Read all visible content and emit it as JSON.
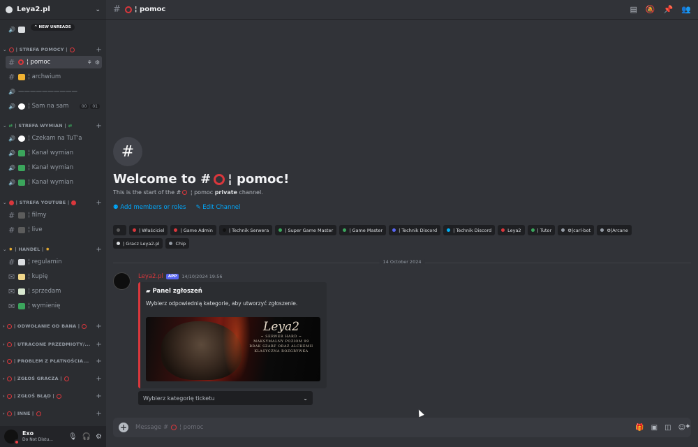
{
  "server": {
    "name": "Leya2.pl",
    "new_unreads": "NEW UNREADS"
  },
  "sidebar": {
    "top_channel": "",
    "categories": [
      {
        "label": "| STREFA POMOCY |"
      },
      {
        "label": "| STREFA WYMIAN |"
      },
      {
        "label": "| STREFA YOUTUBE |"
      },
      {
        "label": "| HANDEL |"
      },
      {
        "label": "| ODWOŁANIE OD BANA |"
      },
      {
        "label": "| UTRACONE PRZEDMIOTY/..."
      },
      {
        "label": "| PROBLEM Z PŁATNOŚCIA..."
      },
      {
        "label": "| ZGŁOŚ GRACZA |"
      },
      {
        "label": "| ZGŁOŚ BŁĄD |"
      },
      {
        "label": "| INNE |"
      }
    ],
    "channels": [
      {
        "label": "¦ pomoc"
      },
      {
        "label": "¦ archwium"
      },
      {
        "label": "——————————"
      },
      {
        "label": "¦ Sam na sam",
        "badge1": "00",
        "badge2": "01"
      },
      {
        "label": "¦ Czekam na TuT'a"
      },
      {
        "label": "¦ Kanał wymian"
      },
      {
        "label": "¦ Kanał wymian"
      },
      {
        "label": "¦ Kanał wymian"
      },
      {
        "label": "¦ filmy"
      },
      {
        "label": "¦ live"
      },
      {
        "label": "¦ regulamin"
      },
      {
        "label": "¦ kupię"
      },
      {
        "label": "¦ sprzedam"
      },
      {
        "label": "¦ wymienię"
      }
    ]
  },
  "user": {
    "name": "Exo",
    "status": "Do Not Distu..."
  },
  "topbar": {
    "channel": "¦ pomoc"
  },
  "welcome": {
    "title_prefix": "Welcome to #",
    "title_channel": "¦ pomoc!",
    "sub_prefix": "This is the start of the #",
    "sub_channel": "¦ pomoc",
    "sub_private": "private",
    "sub_suffix": "channel.",
    "add_members": "Add members or roles",
    "edit_channel": "Edit Channel"
  },
  "roles": [
    {
      "label": "",
      "color": "#5d5d5d"
    },
    {
      "label": "| Właściciel",
      "color": "#da373c"
    },
    {
      "label": "| Game Admin",
      "color": "#da373c"
    },
    {
      "label": "| Technik Serwera",
      "color": "#111111"
    },
    {
      "label": "| Super Game Master",
      "color": "#3ba55c"
    },
    {
      "label": "| Game Master",
      "color": "#3ba55c"
    },
    {
      "label": "| Technik Discord",
      "color": "#5865f2"
    },
    {
      "label": "| Technik Discord",
      "color": "#00b0f4"
    },
    {
      "label": "Leya2",
      "color": "#da373c"
    },
    {
      "label": "| Tutor",
      "color": "#3ba55c"
    },
    {
      "label": "⚙|carl-bot",
      "color": "#949ba4"
    },
    {
      "label": "⚙|Arcane",
      "color": "#949ba4"
    },
    {
      "label": "| Gracz Leya2.pl",
      "color": "#dbdee1"
    },
    {
      "label": "Chip",
      "color": "#949ba4"
    }
  ],
  "date_divider": "14 October 2024",
  "message": {
    "author": "Leya2.pl",
    "app_badge": "APP",
    "time": "14/10/2024 19:56",
    "embed_title": "Panel zgłoszeń",
    "embed_desc": "Wybierz odpowiednią kategorie, aby utworzyć zgłoszenie.",
    "image": {
      "logo": "Leya2",
      "lines": [
        "~ SERWER HARD ~",
        "MAKSYMALNY POZIOM 99",
        "BRAK SZARF ORAZ ALCHEMII",
        "KLASYCZNA ROZGRYWKA"
      ]
    },
    "select_placeholder": "Wybierz kategorię ticketu"
  },
  "composer": {
    "prefix": "Message #",
    "channel": "¦ pomoc"
  }
}
